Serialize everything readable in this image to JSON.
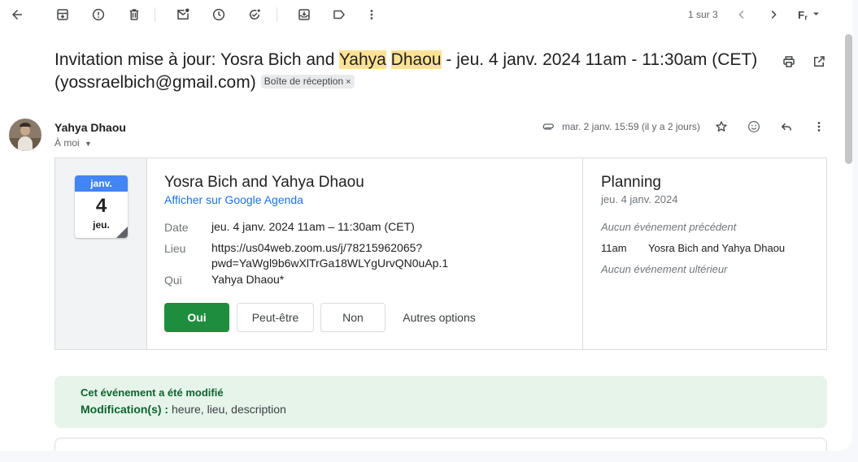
{
  "toolbar": {
    "pager_text": "1 sur 3",
    "icons": [
      "back-arrow-icon",
      "archive-icon",
      "report-spam-icon",
      "delete-icon",
      "mark-unread-icon",
      "snooze-icon",
      "add-task-icon",
      "move-to-icon",
      "label-icon",
      "more-vert-icon",
      "chevron-left-icon",
      "chevron-right-icon",
      "input-tools-icon"
    ]
  },
  "email": {
    "subject_pre": "Invitation mise à jour: Yosra Bich and ",
    "subject_hl1": "Yahya",
    "subject_hl2": "Dhaou",
    "subject_post": " - jeu. 4 janv. 2024 11am - 11:30am (CET) (yossraelbich@gmail.com)",
    "label_chip": "Boîte de réception",
    "sender_name": "Yahya Dhaou",
    "to_text": "À moi",
    "date_text": "mar. 2 janv. 15:59 (il y a 2 jours)"
  },
  "invite": {
    "cal_month": "janv.",
    "cal_day": "4",
    "cal_weekday": "jeu.",
    "title": "Yosra Bich and Yahya Dhaou",
    "calendar_link": "Afficher sur Google Agenda",
    "date_label": "Date",
    "date_value": "jeu. 4 janv. 2024 11am – 11:30am (CET)",
    "location_label": "Lieu",
    "location_line1": "https://us04web.zoom.us/j/78215962065?",
    "location_line2": "pwd=YaWgl9b6wXlTrGa18WLYgUrvQN0uAp.1",
    "who_label": "Qui",
    "who_value": "Yahya Dhaou*",
    "btn_yes": "Oui",
    "btn_maybe": "Peut-être",
    "btn_no": "Non",
    "btn_more": "Autres options"
  },
  "planning": {
    "title": "Planning",
    "date": "jeu. 4 janv. 2024",
    "no_previous": "Aucun événement précédent",
    "event_time": "11am",
    "event_title": "Yosra Bich and Yahya Dhaou",
    "no_next": "Aucun événement ultérieur"
  },
  "modified": {
    "title": "Cet événement a été modifié",
    "label": "Modification(s) :",
    "value": " heure, lieu, description"
  },
  "colors": {
    "accept_green": "#1e8e3e",
    "link_blue": "#1a73e8",
    "highlight": "#fde293",
    "notice_bg": "#e6f4ea"
  }
}
